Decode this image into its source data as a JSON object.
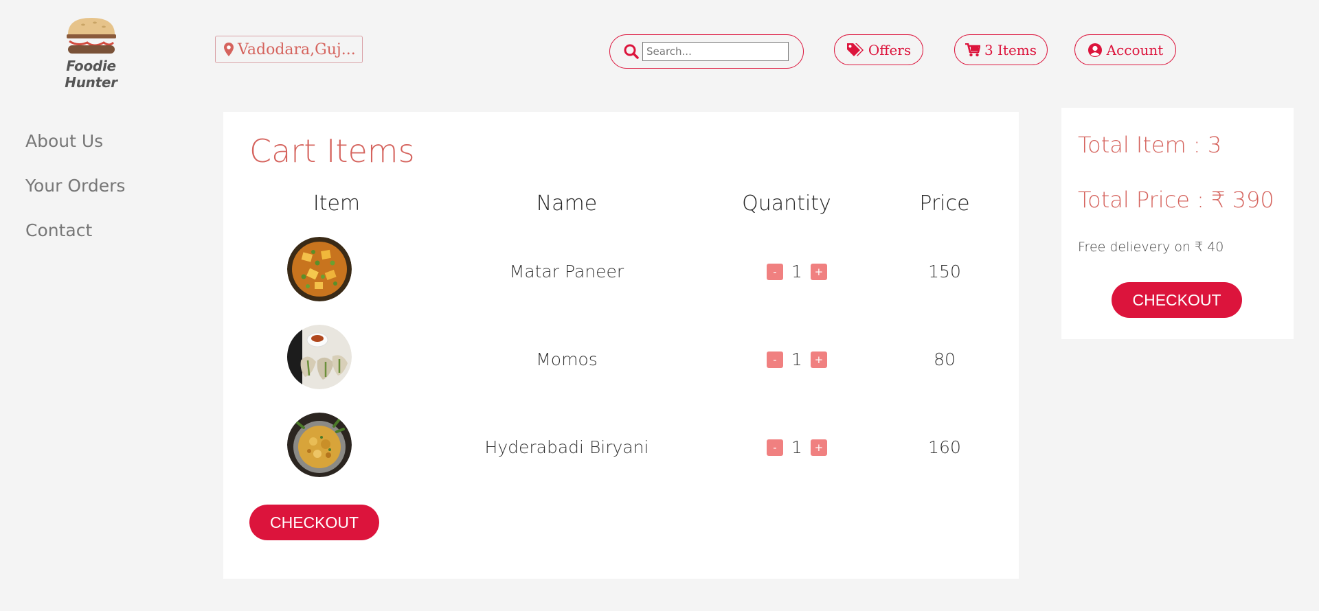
{
  "brand": {
    "name": "Foodie Hunter"
  },
  "header": {
    "location": "Vadodara,Guj...",
    "search_placeholder": "Search...",
    "offers_label": "Offers",
    "cart_label": "3 Items",
    "account_label": "Account"
  },
  "sidebar": {
    "items": [
      {
        "label": "About Us"
      },
      {
        "label": "Your Orders"
      },
      {
        "label": "Contact"
      }
    ]
  },
  "cart": {
    "title": "Cart Items",
    "columns": {
      "item": "Item",
      "name": "Name",
      "quantity": "Quantity",
      "price": "Price"
    },
    "rows": [
      {
        "name": "Matar Paneer",
        "quantity": "1",
        "price": "150",
        "image": "matar-paneer"
      },
      {
        "name": "Momos",
        "quantity": "1",
        "price": "80",
        "image": "momos"
      },
      {
        "name": "Hyderabadi Biryani",
        "quantity": "1",
        "price": "160",
        "image": "hyderabadi-biryani"
      }
    ],
    "decrement_label": "-",
    "increment_label": "+",
    "checkout_label": "CHECKOUT"
  },
  "summary": {
    "total_items": "Total Item : 3",
    "total_price": "Total Price : ₹ 390",
    "free_delivery": "Free delievery on ₹ 40",
    "checkout_label": "CHECKOUT"
  },
  "colors": {
    "accent": "#dc143c",
    "title": "#d5635d",
    "qty_button": "#f08080",
    "background": "#f4f4f4"
  },
  "icons": [
    "burger-logo",
    "map-marker-icon",
    "search-icon",
    "tags-icon",
    "cart-icon",
    "user-circle-icon"
  ]
}
